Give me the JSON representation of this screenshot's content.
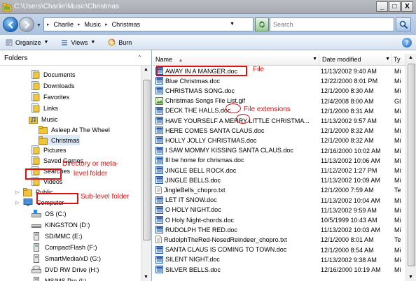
{
  "window": {
    "title": "C:\\Users\\Charlie\\Music\\Christmas",
    "min": "_",
    "max": "□",
    "close": "X"
  },
  "address": {
    "crumbs": [
      "Charlie",
      "Music",
      "Christmas"
    ],
    "search_placeholder": "Search"
  },
  "toolbar": {
    "organize": "Organize",
    "views": "Views",
    "burn": "Burn",
    "help": "?"
  },
  "folders": {
    "header": "Folders",
    "items": [
      {
        "label": "Documents",
        "icon": "documents-folder-icon"
      },
      {
        "label": "Downloads",
        "icon": "downloads-folder-icon"
      },
      {
        "label": "Favorites",
        "icon": "favorites-folder-icon"
      },
      {
        "label": "Links",
        "icon": "links-folder-icon"
      },
      {
        "label": "Music",
        "icon": "music-folder-icon"
      },
      {
        "label": "Asleep At The Wheel",
        "icon": "folder-icon"
      },
      {
        "label": "Christmas",
        "icon": "folder-icon"
      },
      {
        "label": "Pictures",
        "icon": "pictures-folder-icon"
      },
      {
        "label": "Saved Games",
        "icon": "saved-games-folder-icon"
      },
      {
        "label": "Searches",
        "icon": "searches-folder-icon"
      },
      {
        "label": "Videos",
        "icon": "videos-folder-icon"
      },
      {
        "label": "Public",
        "icon": "folder-icon"
      },
      {
        "label": "Computer",
        "icon": "computer-icon"
      },
      {
        "label": "OS (C:)",
        "icon": "hard-drive-icon"
      },
      {
        "label": "KINGSTON (D:)",
        "icon": "usb-drive-icon"
      },
      {
        "label": "SD/MMC (E:)",
        "icon": "card-drive-icon"
      },
      {
        "label": "CompactFlash (F:)",
        "icon": "card-drive-icon"
      },
      {
        "label": "SmartMedia/xD (G:)",
        "icon": "card-drive-icon"
      },
      {
        "label": "DVD RW Drive (H:)",
        "icon": "dvd-drive-icon"
      },
      {
        "label": "MS/MS Pro (I:)",
        "icon": "card-drive-icon"
      }
    ]
  },
  "columns": {
    "name": "Name",
    "date": "Date modified",
    "type": "Ty"
  },
  "files": [
    {
      "name": "AWAY IN A MANGER.doc",
      "date": "11/13/2002 9:40 AM",
      "type": "Mi",
      "icon": "word-doc-icon"
    },
    {
      "name": "Blue Christmas.doc",
      "date": "12/22/2000 8:01 PM",
      "type": "Mi",
      "icon": "word-doc-icon"
    },
    {
      "name": "CHRISTMAS SONG.doc",
      "date": "12/1/2000 8:30 AM",
      "type": "Mi",
      "icon": "word-doc-icon"
    },
    {
      "name": "Christmas Songs File List.gif",
      "date": "12/4/2008 8:00 AM",
      "type": "GI",
      "icon": "gif-image-icon"
    },
    {
      "name": "DECK THE HALLS.doc",
      "date": "12/1/2000 8:31 AM",
      "type": "Mi",
      "icon": "word-doc-icon"
    },
    {
      "name": "HAVE YOURSELF A MERRY LITTLE CHRISTMA...",
      "date": "11/13/2002 9:57 AM",
      "type": "Mi",
      "icon": "word-doc-icon"
    },
    {
      "name": "HERE COMES SANTA CLAUS.doc",
      "date": "12/1/2000 8:32 AM",
      "type": "Mi",
      "icon": "word-doc-icon"
    },
    {
      "name": "HOLLY JOLLY CHRISTMAS.doc",
      "date": "12/1/2000 8:32 AM",
      "type": "Mi",
      "icon": "word-doc-icon"
    },
    {
      "name": "I SAW MOMMY KISSING SANTA CLAUS.doc",
      "date": "12/16/2000 10:02 AM",
      "type": "Mi",
      "icon": "word-doc-icon"
    },
    {
      "name": "Ill be home for chrismas.doc",
      "date": "11/13/2002 10:06 AM",
      "type": "Mi",
      "icon": "word-doc-icon"
    },
    {
      "name": "JINGLE BELL ROCK.doc",
      "date": "11/12/2002 1:27 PM",
      "type": "Mi",
      "icon": "word-doc-icon"
    },
    {
      "name": "JINGLE BELLS.doc",
      "date": "11/13/2002 10:09 AM",
      "type": "Mi",
      "icon": "word-doc-icon"
    },
    {
      "name": "JingleBells_chopro.txt",
      "date": "12/1/2000 7:59 AM",
      "type": "Te",
      "icon": "text-file-icon"
    },
    {
      "name": "LET IT SNOW.doc",
      "date": "11/13/2002 10:04 AM",
      "type": "Mi",
      "icon": "word-doc-icon"
    },
    {
      "name": "O HOLY NIGHT.doc",
      "date": "11/13/2002 9:59 AM",
      "type": "Mi",
      "icon": "word-doc-icon"
    },
    {
      "name": "O Holy Night-chords.doc",
      "date": "10/5/1999 10:43 AM",
      "type": "Mi",
      "icon": "word-doc-icon"
    },
    {
      "name": "RUDOLPH THE RED.doc",
      "date": "11/13/2002 10:03 AM",
      "type": "Mi",
      "icon": "word-doc-icon"
    },
    {
      "name": "RudolphTheRed-NosedReindeer_chopro.txt",
      "date": "12/1/2000 8:01 AM",
      "type": "Te",
      "icon": "text-file-icon"
    },
    {
      "name": "SANTA CLAUS IS COMING TO TOWN.doc",
      "date": "12/1/2000 8:54 AM",
      "type": "Mi",
      "icon": "word-doc-icon"
    },
    {
      "name": "SILENT NIGHT.doc",
      "date": "11/13/2002 9:38 AM",
      "type": "Mi",
      "icon": "word-doc-icon"
    },
    {
      "name": "SILVER BELLS.doc",
      "date": "12/16/2000 10:19 AM",
      "type": "Mi",
      "icon": "word-doc-icon"
    }
  ],
  "annotations": {
    "file": "File",
    "file_extensions": "File extensions",
    "directory_line1": "Directory or meta-",
    "directory_line2": "level folder",
    "sublevel": "Sub-level folder"
  },
  "colors": {
    "annotation": "#e01010",
    "title_bar": "#b0b4ba",
    "address_bar": "#b8cce6"
  }
}
